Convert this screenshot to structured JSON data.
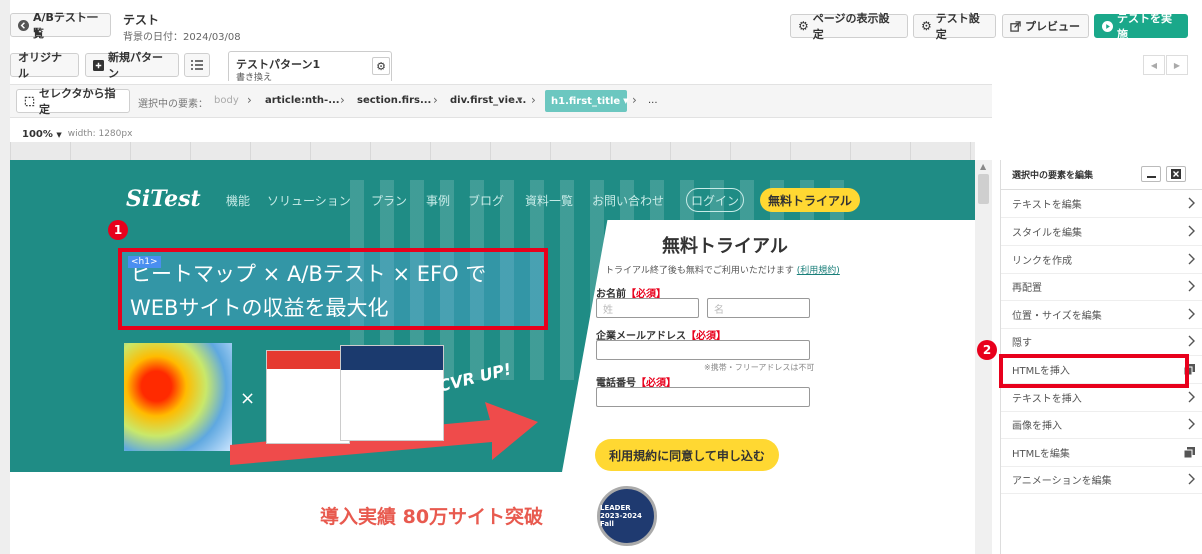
{
  "header": {
    "back_label": "A/Bテスト一覧",
    "title": "テスト",
    "date_label": "背景の日付：",
    "date_value": "2024/03/08",
    "page_settings_label": "ページの表示設定",
    "test_settings_label": "テスト設定",
    "preview_label": "プレビュー",
    "run_label": "テストを実施"
  },
  "patterns": {
    "original_label": "オリジナル",
    "new_pattern_label": "新規パターン",
    "active_pattern_name": "テストパターン1",
    "active_pattern_type": "書き換え"
  },
  "selector": {
    "button_label": "セレクタから指定",
    "current_label": "選択中の要素：",
    "crumbs": [
      "body",
      "article:nth-...",
      "section.firs...",
      "div.first_vie...",
      "h1.first_title"
    ],
    "ellipsis": "..."
  },
  "ruler": {
    "zoom": "100%",
    "width_label": "width: 1280px"
  },
  "preview": {
    "logo": "SiTest",
    "nav": [
      "機能",
      "ソリューション",
      "プラン",
      "事例",
      "ブログ",
      "資料一覧",
      "お問い合わせ"
    ],
    "login": "ログイン",
    "trial": "無料トライアル",
    "h1_tag": "<h1>",
    "headline_line1": "ヒートマップ × A/Bテスト × EFO で",
    "headline_line2": "WEBサイトの収益を最大化",
    "times": "×",
    "cvr": "CVR UP!",
    "form": {
      "title": "無料トライアル",
      "note": "トライアル終了後も無料でご利用いただけます",
      "note_link": "(利用規約)",
      "name_label": "お名前",
      "required": "【必須】",
      "last_name_placeholder": "姓",
      "first_name_placeholder": "名",
      "email_label": "企業メールアドレス",
      "email_note": "※携帯・フリーアドレスは不可",
      "phone_label": "電話番号",
      "submit": "利用規約に同意して申し込む"
    },
    "achievement": "導入実績 80万サイト突破",
    "badge_text": "LEADER 2023-2024 Fall"
  },
  "panel": {
    "title": "選択中の要素を編集",
    "items": [
      "テキストを編集",
      "スタイルを編集",
      "リンクを作成",
      "再配置",
      "位置・サイズを編集",
      "隠す",
      "HTMLを挿入",
      "テキストを挿入",
      "画像を挿入",
      "HTMLを編集",
      "アニメーションを編集"
    ]
  },
  "annotations": {
    "badge1": "1",
    "badge2": "2"
  },
  "colors": {
    "accent_green": "#1aa88a",
    "teal": "#6cc7c0",
    "highlight_red": "#e8001c",
    "yellow": "#ffd832"
  }
}
